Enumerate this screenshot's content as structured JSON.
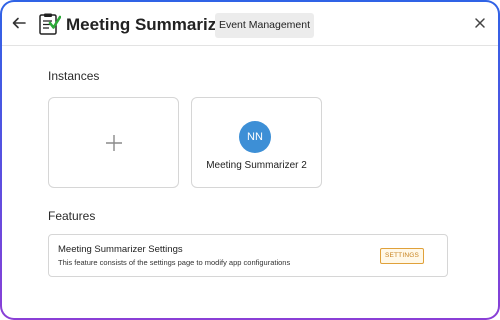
{
  "header": {
    "title": "Meeting Summarizer",
    "tag_label": "Event Management",
    "back_icon": "arrow-left-icon",
    "app_icon": "checklist-icon",
    "close_icon": "close-icon"
  },
  "instances": {
    "section_title": "Instances",
    "add_icon": "plus-icon",
    "items": [
      {
        "initials": "NN",
        "name": "Meeting Summarizer 2",
        "avatar_color": "#3d8fd6"
      }
    ]
  },
  "features": {
    "section_title": "Features",
    "items": [
      {
        "name": "Meeting Summarizer Settings",
        "description": "This feature consists of the settings page to modify app configurations",
        "button_label": "SETTINGS"
      }
    ]
  },
  "colors": {
    "frame_gradient_start": "#2f63e6",
    "frame_gradient_end": "#8a3fd6",
    "settings_accent": "#e0a13a"
  }
}
